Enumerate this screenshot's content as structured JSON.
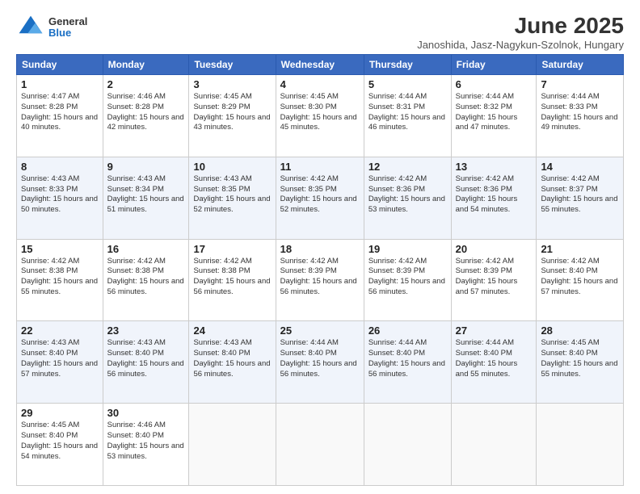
{
  "header": {
    "logo_general": "General",
    "logo_blue": "Blue",
    "main_title": "June 2025",
    "subtitle": "Janoshida, Jasz-Nagykun-Szolnok, Hungary"
  },
  "days_of_week": [
    "Sunday",
    "Monday",
    "Tuesday",
    "Wednesday",
    "Thursday",
    "Friday",
    "Saturday"
  ],
  "weeks": [
    [
      {
        "day": "1",
        "sunrise": "4:47 AM",
        "sunset": "8:28 PM",
        "daylight": "15 hours and 40 minutes."
      },
      {
        "day": "2",
        "sunrise": "4:46 AM",
        "sunset": "8:28 PM",
        "daylight": "15 hours and 42 minutes."
      },
      {
        "day": "3",
        "sunrise": "4:45 AM",
        "sunset": "8:29 PM",
        "daylight": "15 hours and 43 minutes."
      },
      {
        "day": "4",
        "sunrise": "4:45 AM",
        "sunset": "8:30 PM",
        "daylight": "15 hours and 45 minutes."
      },
      {
        "day": "5",
        "sunrise": "4:44 AM",
        "sunset": "8:31 PM",
        "daylight": "15 hours and 46 minutes."
      },
      {
        "day": "6",
        "sunrise": "4:44 AM",
        "sunset": "8:32 PM",
        "daylight": "15 hours and 47 minutes."
      },
      {
        "day": "7",
        "sunrise": "4:44 AM",
        "sunset": "8:33 PM",
        "daylight": "15 hours and 49 minutes."
      }
    ],
    [
      {
        "day": "8",
        "sunrise": "4:43 AM",
        "sunset": "8:33 PM",
        "daylight": "15 hours and 50 minutes."
      },
      {
        "day": "9",
        "sunrise": "4:43 AM",
        "sunset": "8:34 PM",
        "daylight": "15 hours and 51 minutes."
      },
      {
        "day": "10",
        "sunrise": "4:43 AM",
        "sunset": "8:35 PM",
        "daylight": "15 hours and 52 minutes."
      },
      {
        "day": "11",
        "sunrise": "4:42 AM",
        "sunset": "8:35 PM",
        "daylight": "15 hours and 52 minutes."
      },
      {
        "day": "12",
        "sunrise": "4:42 AM",
        "sunset": "8:36 PM",
        "daylight": "15 hours and 53 minutes."
      },
      {
        "day": "13",
        "sunrise": "4:42 AM",
        "sunset": "8:36 PM",
        "daylight": "15 hours and 54 minutes."
      },
      {
        "day": "14",
        "sunrise": "4:42 AM",
        "sunset": "8:37 PM",
        "daylight": "15 hours and 55 minutes."
      }
    ],
    [
      {
        "day": "15",
        "sunrise": "4:42 AM",
        "sunset": "8:38 PM",
        "daylight": "15 hours and 55 minutes."
      },
      {
        "day": "16",
        "sunrise": "4:42 AM",
        "sunset": "8:38 PM",
        "daylight": "15 hours and 56 minutes."
      },
      {
        "day": "17",
        "sunrise": "4:42 AM",
        "sunset": "8:38 PM",
        "daylight": "15 hours and 56 minutes."
      },
      {
        "day": "18",
        "sunrise": "4:42 AM",
        "sunset": "8:39 PM",
        "daylight": "15 hours and 56 minutes."
      },
      {
        "day": "19",
        "sunrise": "4:42 AM",
        "sunset": "8:39 PM",
        "daylight": "15 hours and 56 minutes."
      },
      {
        "day": "20",
        "sunrise": "4:42 AM",
        "sunset": "8:39 PM",
        "daylight": "15 hours and 57 minutes."
      },
      {
        "day": "21",
        "sunrise": "4:42 AM",
        "sunset": "8:40 PM",
        "daylight": "15 hours and 57 minutes."
      }
    ],
    [
      {
        "day": "22",
        "sunrise": "4:43 AM",
        "sunset": "8:40 PM",
        "daylight": "15 hours and 57 minutes."
      },
      {
        "day": "23",
        "sunrise": "4:43 AM",
        "sunset": "8:40 PM",
        "daylight": "15 hours and 56 minutes."
      },
      {
        "day": "24",
        "sunrise": "4:43 AM",
        "sunset": "8:40 PM",
        "daylight": "15 hours and 56 minutes."
      },
      {
        "day": "25",
        "sunrise": "4:44 AM",
        "sunset": "8:40 PM",
        "daylight": "15 hours and 56 minutes."
      },
      {
        "day": "26",
        "sunrise": "4:44 AM",
        "sunset": "8:40 PM",
        "daylight": "15 hours and 56 minutes."
      },
      {
        "day": "27",
        "sunrise": "4:44 AM",
        "sunset": "8:40 PM",
        "daylight": "15 hours and 55 minutes."
      },
      {
        "day": "28",
        "sunrise": "4:45 AM",
        "sunset": "8:40 PM",
        "daylight": "15 hours and 55 minutes."
      }
    ],
    [
      {
        "day": "29",
        "sunrise": "4:45 AM",
        "sunset": "8:40 PM",
        "daylight": "15 hours and 54 minutes."
      },
      {
        "day": "30",
        "sunrise": "4:46 AM",
        "sunset": "8:40 PM",
        "daylight": "15 hours and 53 minutes."
      },
      null,
      null,
      null,
      null,
      null
    ]
  ]
}
